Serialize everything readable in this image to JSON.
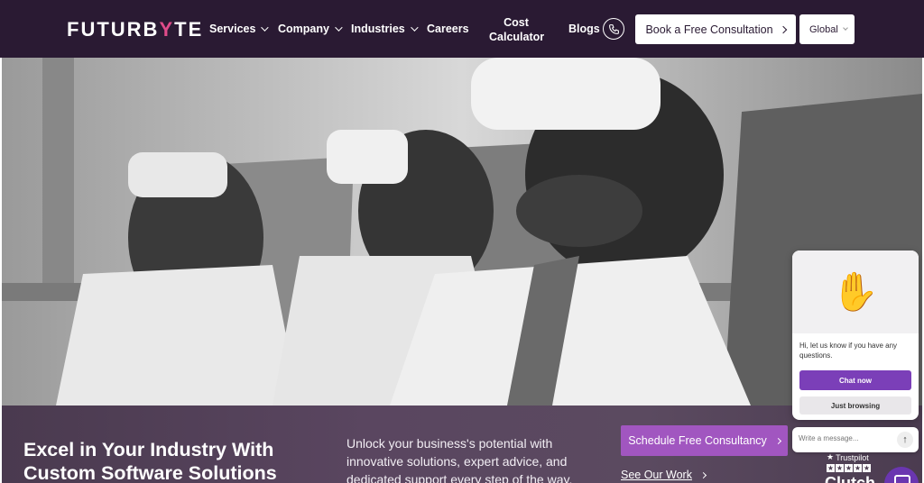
{
  "nav": {
    "logo_left": "FUTURB",
    "logo_mid": "Y",
    "logo_right": "TE",
    "items": [
      {
        "label": "Services",
        "dropdown": true
      },
      {
        "label": "Company",
        "dropdown": true
      },
      {
        "label": "Industries",
        "dropdown": true
      },
      {
        "label": "Careers",
        "dropdown": false
      }
    ],
    "cost_line1": "Cost",
    "cost_line2": "Calculator",
    "blogs": "Blogs",
    "phone_icon": "phone-icon",
    "book_label": "Book a Free Consultation",
    "region": "Global"
  },
  "hero": {
    "image_alt": "People wearing VR headsets"
  },
  "band": {
    "headline_1": "Excel in Your Industry With",
    "headline_2": "Custom Software Solutions",
    "subtext": "Unlock your business's potential with innovative solutions, expert advice, and dedicated support every step of the way.",
    "schedule_label": "Schedule Free Consultancy",
    "see_work_label": "See Our Work",
    "trustpilot": "Trustpilot",
    "clutch": "Clutch"
  },
  "chat": {
    "wave": "✋",
    "message": "Hi, let us know if you have any questions.",
    "chat_now": "Chat now",
    "just_browsing": "Just browsing",
    "input_placeholder": "Write a message...",
    "send_icon": "arrow-up-icon"
  },
  "colors": {
    "nav_bg": "#2a1a33",
    "accent": "#a156c0",
    "chat_accent": "#7b3fb8"
  }
}
